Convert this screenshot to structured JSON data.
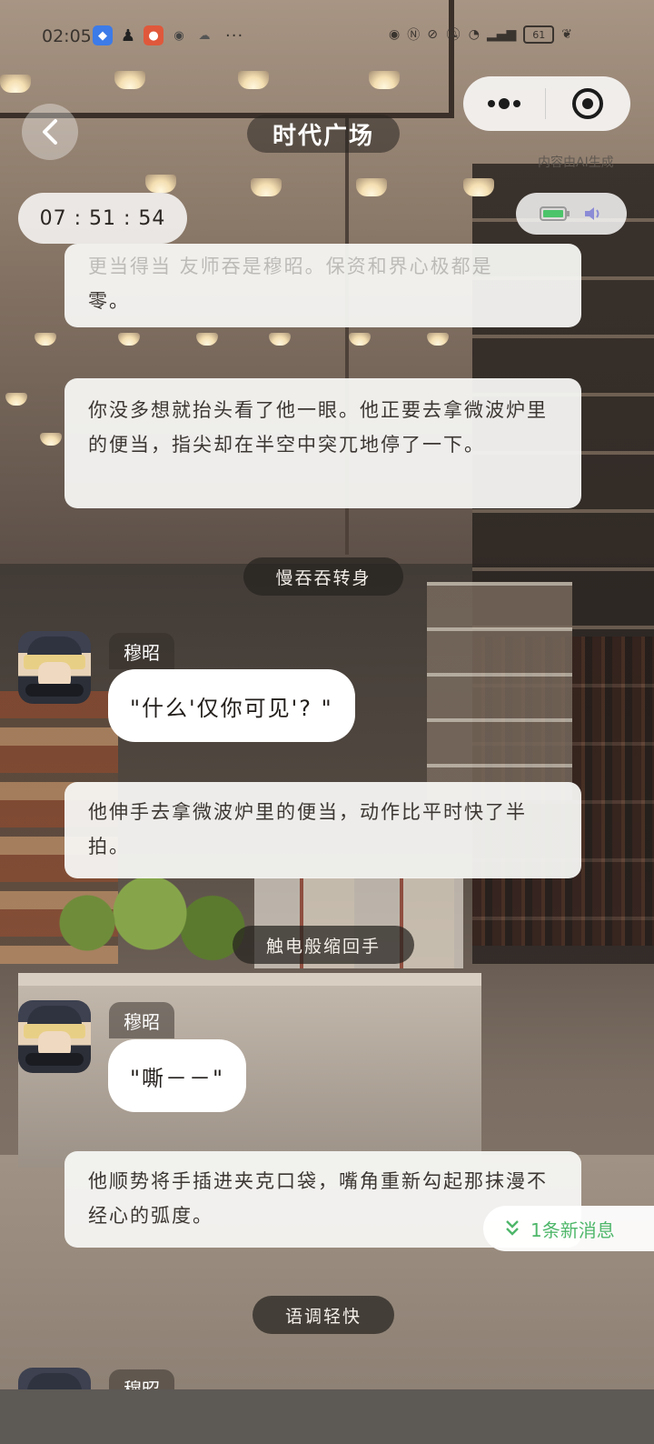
{
  "status_bar": {
    "time": "02:05",
    "more": "···",
    "battery": "61"
  },
  "header": {
    "title": "时代广场",
    "ai_note": "内容由AI生成",
    "timer": "07 : 51 : 54"
  },
  "chat": {
    "narration_top_faded": "更当得当 友师吞是穆昭。保资和界心极都是",
    "narration_top": "零。",
    "narration_1": "你没多想就抬头看了他一眼。他正要去拿微波炉里的便当，指尖却在半空中突兀地停了一下。",
    "action_1": "慢吞吞转身",
    "speaker_1": "穆昭",
    "bubble_1": "\"什么'仅你可见'? \"",
    "narration_2": "他伸手去拿微波炉里的便当，动作比平时快了半拍。",
    "action_2": "触电般缩回手",
    "speaker_2": "穆昭",
    "bubble_2": "\"嘶－－\"",
    "narration_3": "他顺势将手插进夹克口袋，嘴角重新勾起那抹漫不经心的弧度。",
    "action_3": "语调轻快",
    "speaker_3": "穆昭"
  },
  "new_message": {
    "icon": "double-chevron-down-icon",
    "label": "1条新消息"
  },
  "colors": {
    "accent_green": "#4fb76a",
    "bubble_bg": "#ffffff",
    "action_pill_bg": "#26221f"
  }
}
